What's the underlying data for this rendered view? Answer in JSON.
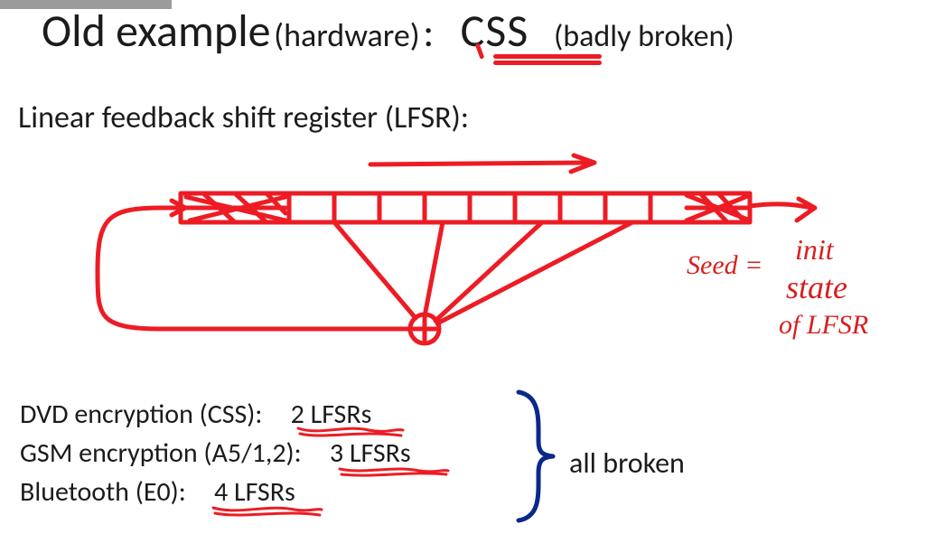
{
  "title": {
    "big": "Old example",
    "hardware": "(hardware)",
    "css": "CSS",
    "note": "(badly broken)"
  },
  "subtitle": "Linear feedback shift register  (LFSR):",
  "handnote": {
    "l1": "Seed =",
    "l2": "init",
    "l3": "state",
    "l4": "of  LFSR"
  },
  "list": {
    "dvd": {
      "label": "DVD encryption (CSS):",
      "value": "2  LFSRs"
    },
    "gsm": {
      "label": "GSM encryption (A5/1,2):",
      "value": "3  LFSRs"
    },
    "bt": {
      "label": "Bluetooth (E0):",
      "value": "4  LFSRs"
    }
  },
  "allbroken": "all broken",
  "colors": {
    "red": "#ed1c24",
    "blue": "#0a2a8a"
  }
}
